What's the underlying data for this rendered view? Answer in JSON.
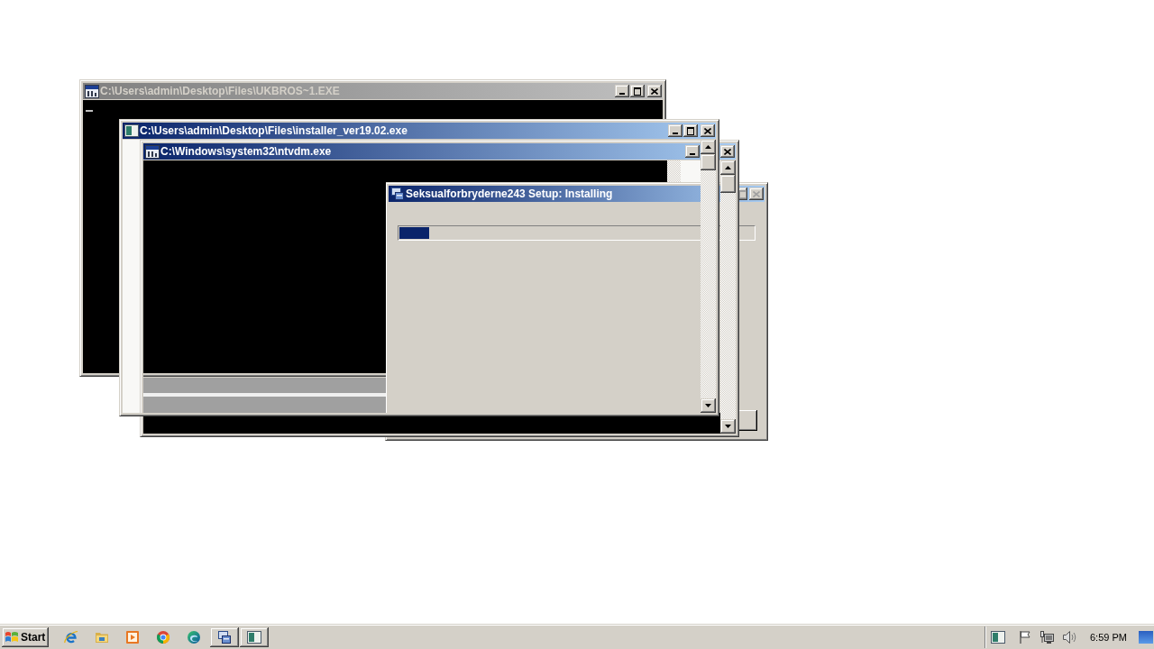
{
  "windows": [
    {
      "kind": "console",
      "title": "C:\\Users\\admin\\Desktop\\Files\\UKBROS~1.EXE",
      "active": false
    },
    {
      "kind": "frame",
      "title": "C:\\Users\\admin\\Desktop\\Files\\installer_ver19.02.exe",
      "active": true
    },
    {
      "kind": "console",
      "title": "C:\\Windows\\system32\\ntvdm.exe",
      "active": true
    },
    {
      "kind": "installer",
      "title": "Seksualforbryderne243 Setup: Installing",
      "active": true,
      "buttons_disabled": true,
      "progress": {
        "level": 0.085
      }
    }
  ],
  "taskbar": {
    "start_label": "Start",
    "clock": "6:59 PM"
  }
}
